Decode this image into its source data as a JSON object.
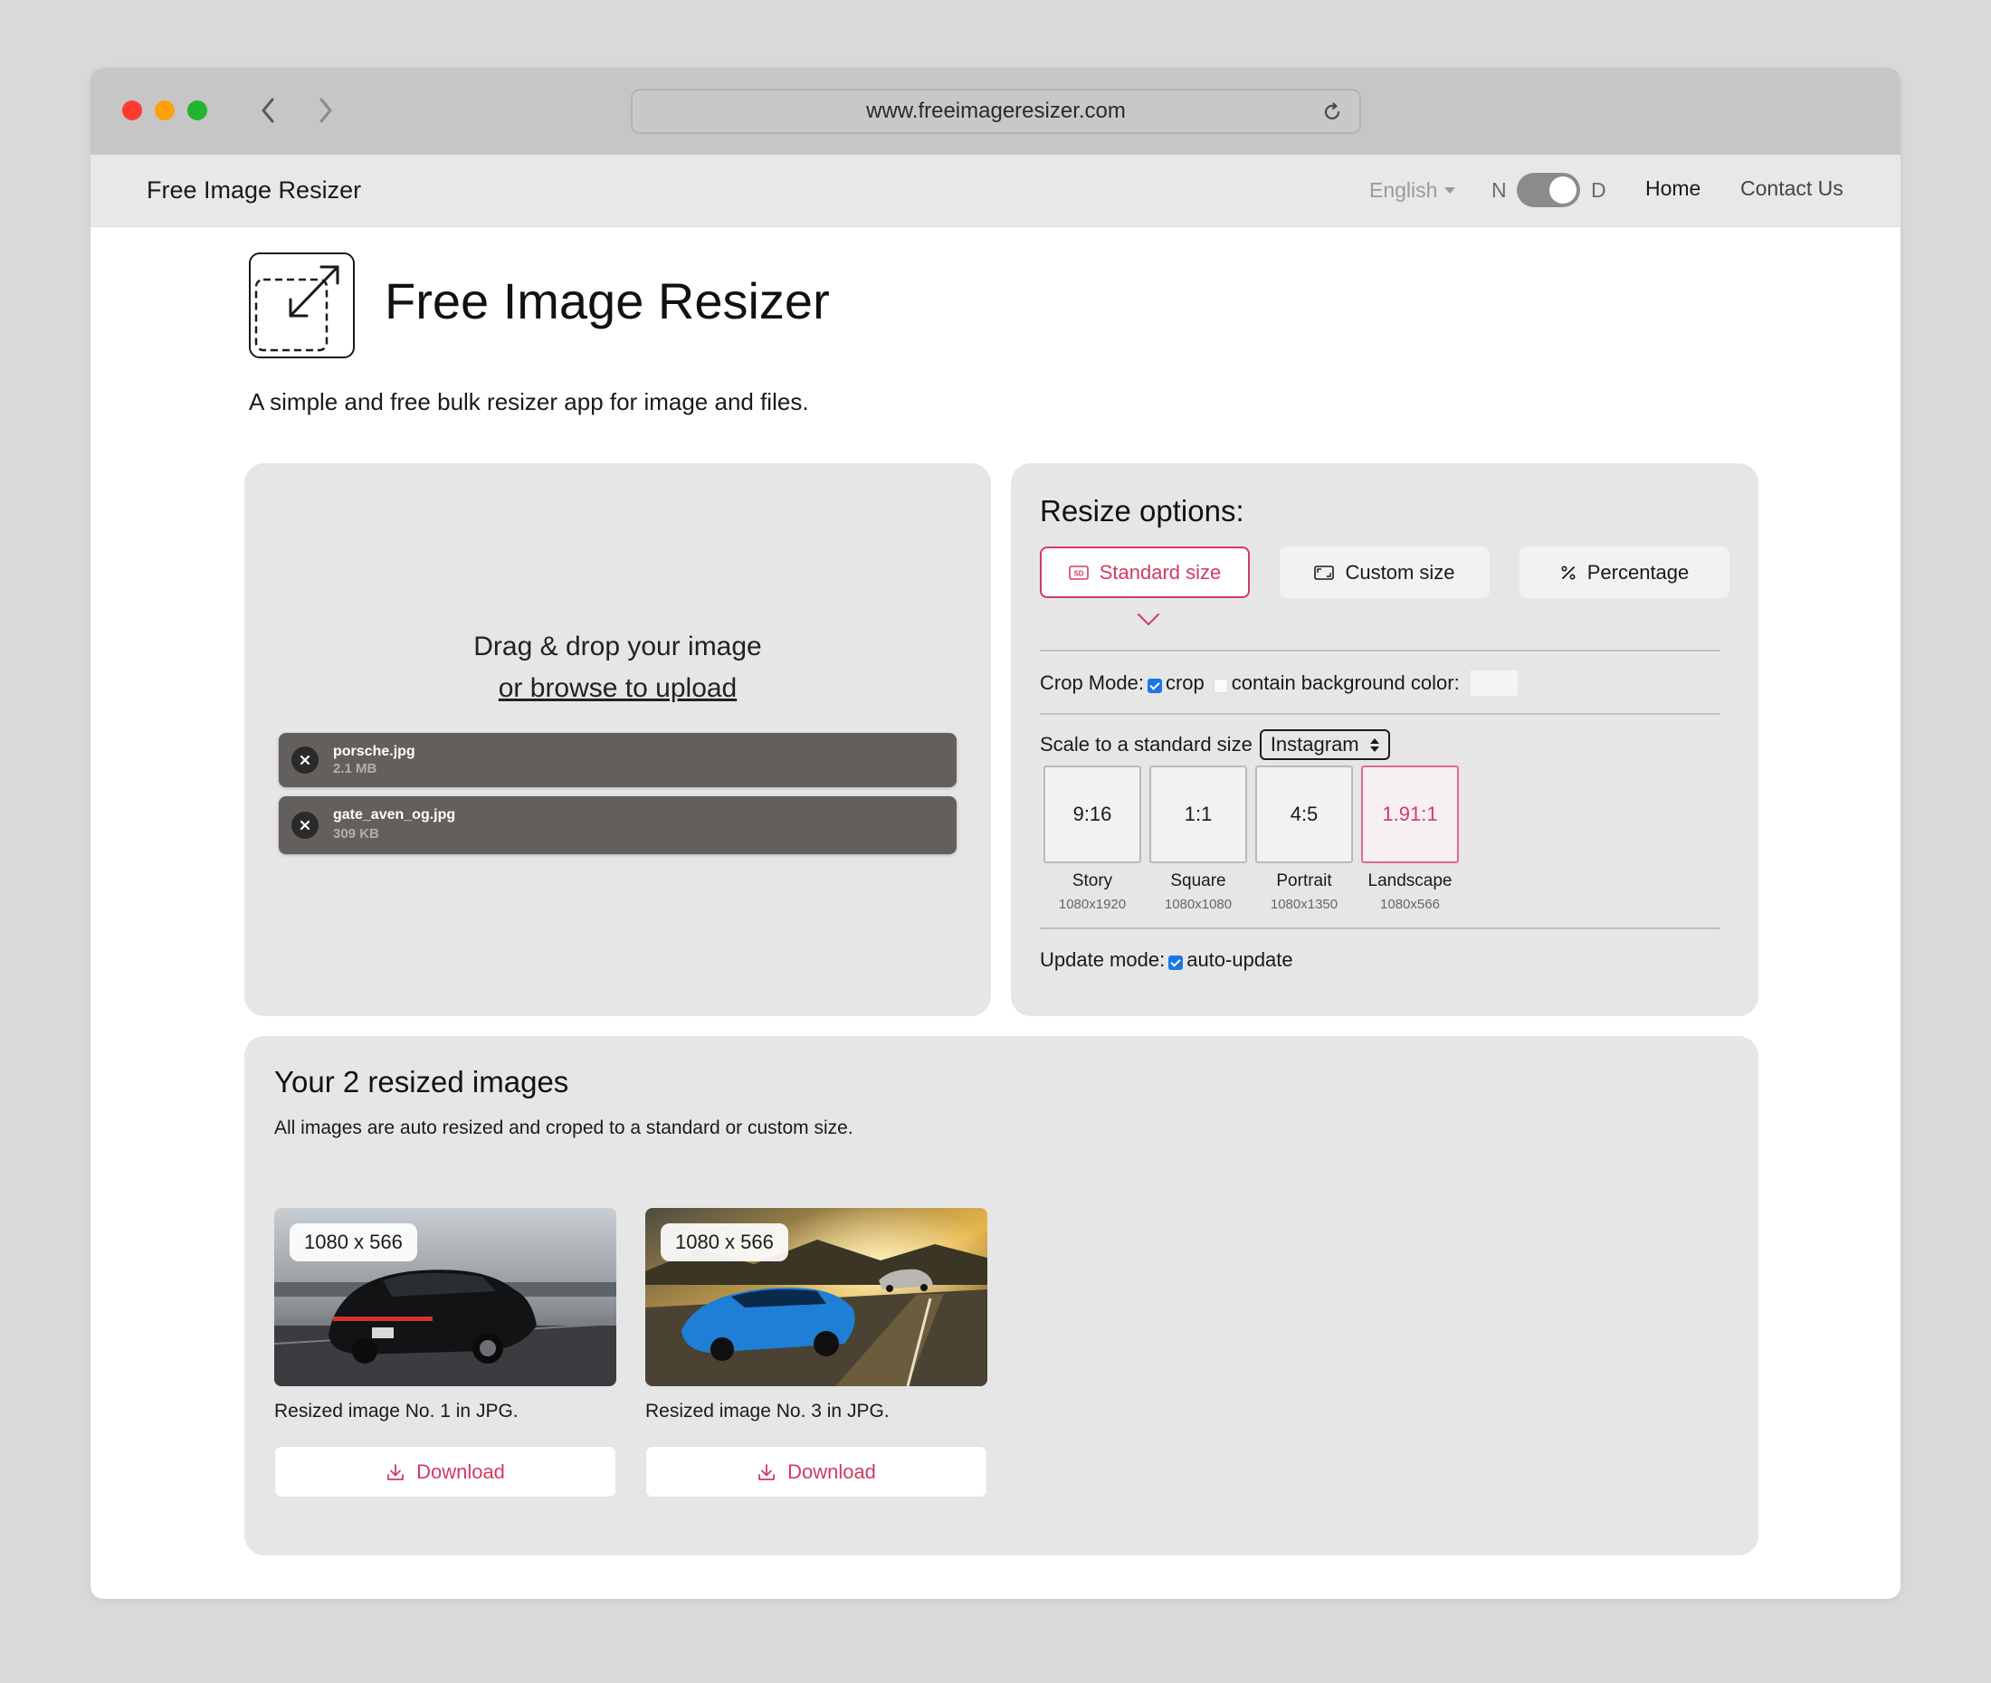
{
  "browser": {
    "url": "www.freeimageresizer.com"
  },
  "nav": {
    "brand": "Free Image Resizer",
    "language": "English",
    "toggle_left": "N",
    "toggle_right": "D",
    "home": "Home",
    "contact": "Contact Us"
  },
  "hero": {
    "title": "Free Image Resizer",
    "subtitle": "A simple and free bulk resizer app for image and files."
  },
  "upload": {
    "drop_text": "Drag & drop your image",
    "browse_text": "or browse to upload",
    "files": [
      {
        "name": "porsche.jpg",
        "size": "2.1 MB"
      },
      {
        "name": "gate_aven_og.jpg",
        "size": "309 KB"
      }
    ]
  },
  "options": {
    "title": "Resize options:",
    "modes": [
      {
        "label": "Standard size",
        "icon": "sd-icon",
        "active": true
      },
      {
        "label": "Custom size",
        "icon": "aspect-ratio-icon",
        "active": false
      },
      {
        "label": "Percentage",
        "icon": "percent-icon",
        "active": false
      }
    ],
    "crop_mode_label": "Crop Mode:",
    "crop_label": "crop",
    "crop_checked": true,
    "contain_label": "contain background color:",
    "contain_checked": false,
    "scale_label": "Scale to a standard size",
    "scale_select": "Instagram",
    "ratios": [
      {
        "ratio": "9:16",
        "name": "Story",
        "dims": "1080x1920",
        "active": false
      },
      {
        "ratio": "1:1",
        "name": "Square",
        "dims": "1080x1080",
        "active": false
      },
      {
        "ratio": "4:5",
        "name": "Portrait",
        "dims": "1080x1350",
        "active": false
      },
      {
        "ratio": "1.91:1",
        "name": "Landscape",
        "dims": "1080x566",
        "active": true
      }
    ],
    "update_mode_label": "Update mode:",
    "auto_update_label": "auto-update",
    "auto_update_checked": true
  },
  "results": {
    "title": "Your 2 resized images",
    "subtitle": "All images are auto resized and croped to a standard or custom size.",
    "items": [
      {
        "badge": "1080 x 566",
        "caption": "Resized image No. 1 in JPG.",
        "button": "Download"
      },
      {
        "badge": "1080 x 566",
        "caption": "Resized image No. 3 in JPG.",
        "button": "Download"
      }
    ]
  },
  "colors": {
    "accent": "#d33a60",
    "checkbox": "#1877e6",
    "panel": "#e6e6e6",
    "file_chip": "#635f5d"
  }
}
